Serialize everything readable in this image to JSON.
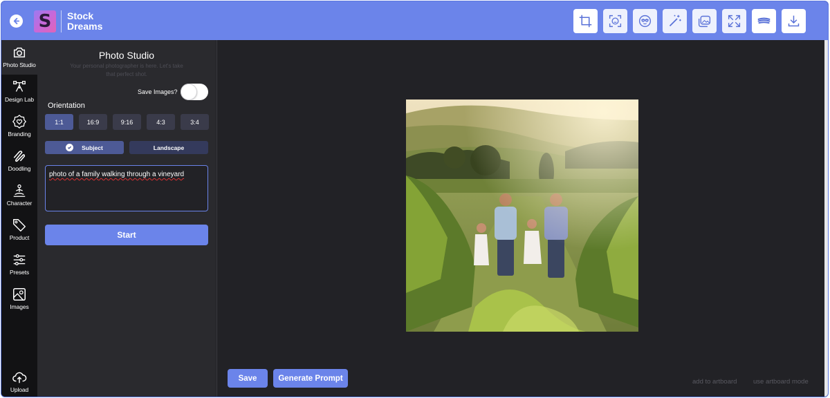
{
  "app": {
    "name_line1": "Stock",
    "name_line2": "Dreams",
    "logo_letter": "S"
  },
  "header": {
    "back_icon": "arrow-left-circle-icon",
    "tools": [
      {
        "name": "crop-icon"
      },
      {
        "name": "face-scan-icon"
      },
      {
        "name": "sunglasses-face-icon"
      },
      {
        "name": "magic-wand-icon"
      },
      {
        "name": "image-layers-icon"
      },
      {
        "name": "expand-arrows-icon"
      },
      {
        "name": "brush-stroke-icon"
      },
      {
        "name": "download-icon"
      }
    ]
  },
  "sidebar": {
    "items": [
      {
        "label": "Photo Studio",
        "icon": "camera-icon",
        "active": true
      },
      {
        "label": "Design Lab",
        "icon": "vector-pen-icon"
      },
      {
        "label": "Branding",
        "icon": "heart-badge-icon"
      },
      {
        "label": "Doodling",
        "icon": "squiggle-icon"
      },
      {
        "label": "Character",
        "icon": "meditation-person-icon"
      },
      {
        "label": "Product",
        "icon": "tag-icon"
      },
      {
        "label": "Presets",
        "icon": "sliders-icon"
      },
      {
        "label": "Images",
        "icon": "image-icon"
      },
      {
        "label": "Upload",
        "icon": "cloud-upload-icon"
      }
    ]
  },
  "panel": {
    "title": "Photo Studio",
    "subtitle": "Your personal photographer is here. Let's take that perfect shot.",
    "save_images_label": "Save Images?",
    "save_images_on": false,
    "orientation_label": "Orientation",
    "orientations": [
      "1:1",
      "16:9",
      "9:16",
      "4:3",
      "3:4"
    ],
    "selected_orientation": "1:1",
    "modes": [
      "Subject",
      "Landscape"
    ],
    "selected_mode": "Subject",
    "prompt": "photo of a family walking through a vineyard",
    "start_label": "Start"
  },
  "canvas": {
    "save_label": "Save",
    "generate_label": "Generate Prompt",
    "add_to_artboard": "add to artboard",
    "use_artboard_mode": "use artboard mode"
  },
  "colors": {
    "accent": "#6b84ea",
    "panel_bg": "#2a2a2e",
    "canvas_bg": "#222226",
    "rail_bg": "#121214"
  }
}
